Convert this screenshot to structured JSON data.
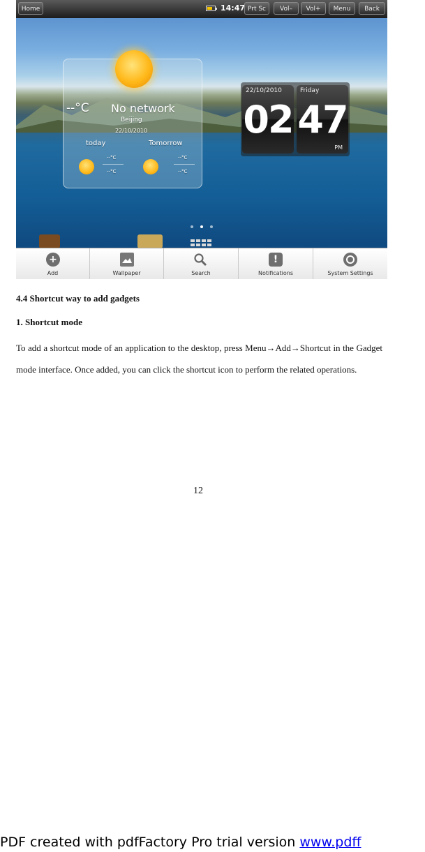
{
  "screenshot": {
    "topbar": {
      "home_label": "Home",
      "time": "14:47",
      "buttons": [
        "Prt Sc",
        "Vol–",
        "Vol+",
        "Menu",
        "Back"
      ]
    },
    "weather": {
      "temp": "--°C",
      "status": "No network",
      "city": "Beijing",
      "date": "22/10/2010",
      "today_label": "today",
      "tomorrow_label": "Tomorrow",
      "today_high": "--°C",
      "today_low": "--°C",
      "tomorrow_high": "--°C",
      "tomorrow_low": "--°C",
      "icon": "sun-icon"
    },
    "clock": {
      "date": "22/10/2010",
      "day": "Friday",
      "hour": "02",
      "minute": "47",
      "ampm": "PM"
    },
    "menu": [
      {
        "label": "Add",
        "icon": "add-icon"
      },
      {
        "label": "Wallpaper",
        "icon": "wallpaper-icon"
      },
      {
        "label": "Search",
        "icon": "search-icon"
      },
      {
        "label": "Notifications",
        "icon": "notifications-icon"
      },
      {
        "label": "System Settings",
        "icon": "settings-icon"
      }
    ]
  },
  "document": {
    "heading": "4.4 Shortcut way to add gadgets",
    "subheading": "1. Shortcut mode",
    "paragraph": "To add a shortcut mode of an application to the desktop, press Menu→Add→Shortcut in the Gadget mode interface. Once added, you can click the shortcut icon to perform the related operations.",
    "page_number": "12"
  },
  "footer": {
    "text": "PDF created with pdfFactory Pro trial version ",
    "link": "www.pdff"
  }
}
